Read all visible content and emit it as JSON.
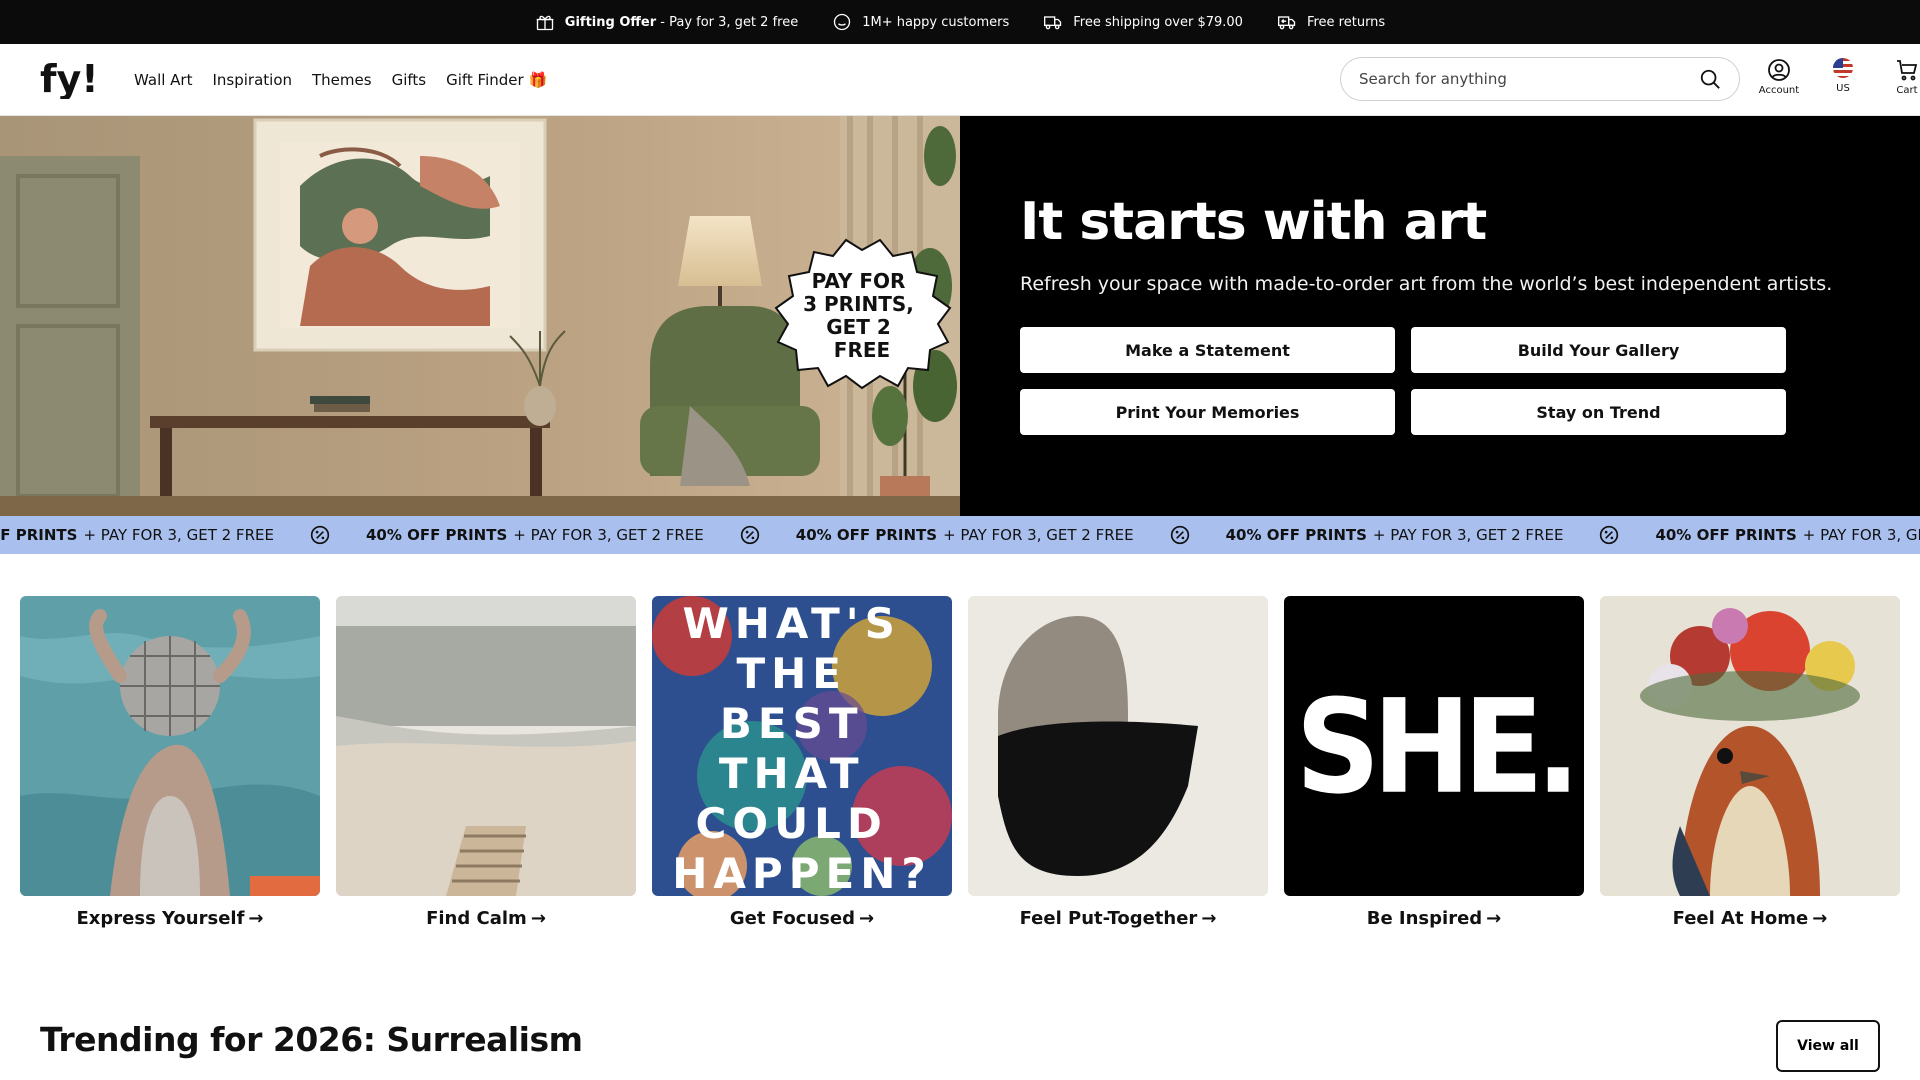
{
  "topbar": {
    "offer_bold": "Gifting Offer",
    "offer_text": " - Pay for 3, get 2 free",
    "customers": "1M+ happy customers",
    "shipping": "Free shipping over $79.00",
    "returns": "Free returns"
  },
  "header": {
    "logo_text": "fy!",
    "nav": [
      "Wall Art",
      "Inspiration",
      "Themes",
      "Gifts",
      "Gift Finder 🎁"
    ],
    "search_placeholder": "Search for anything",
    "account_label": "Account",
    "region_label": "US",
    "cart_label": "Cart"
  },
  "hero": {
    "badge_lines": [
      "PAY FOR",
      "3 PRINTS,",
      "GET 2",
      "FREE"
    ],
    "title": "It starts with art",
    "subtitle": "Refresh your space with made-to-order art from the world’s best independent artists.",
    "buttons": [
      "Make a Statement",
      "Build Your Gallery",
      "Print Your Memories",
      "Stay on Trend"
    ]
  },
  "marquee": {
    "bold": "40% OFF PRINTS",
    "text": "+ PAY FOR 3, GET 2 FREE",
    "partial_first": "FF PRINTS"
  },
  "tiles": [
    {
      "label": "Express Yourself",
      "arrow": "→"
    },
    {
      "label": "Find Calm",
      "arrow": "→"
    },
    {
      "label": "Get Focused",
      "arrow": "→",
      "art_text": [
        "WHAT'S",
        "THE",
        "BEST",
        "THAT",
        "COULD",
        "HAPPEN?"
      ]
    },
    {
      "label": "Feel Put-Together",
      "arrow": "→"
    },
    {
      "label": "Be Inspired",
      "arrow": "→",
      "art_text": "SHE."
    },
    {
      "label": "Feel At Home",
      "arrow": "→"
    }
  ],
  "trending": {
    "title": "Trending for 2026: Surrealism",
    "view_all": "View all"
  },
  "colors": {
    "topbar_bg": "#0b0b0b",
    "marquee_bg": "#a9c0ef",
    "hero_right_bg": "#000000"
  }
}
